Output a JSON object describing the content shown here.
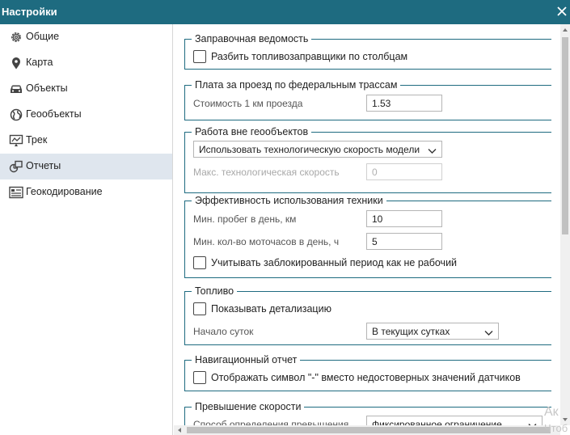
{
  "window": {
    "title": "Настройки",
    "close_icon": "close-icon"
  },
  "sidebar": {
    "items": [
      {
        "label": "Общие",
        "icon": "gear-icon",
        "active": false
      },
      {
        "label": "Карта",
        "icon": "map-pin-icon",
        "active": false
      },
      {
        "label": "Объекты",
        "icon": "car-icon",
        "active": false
      },
      {
        "label": "Геообъекты",
        "icon": "globe-icon",
        "active": false
      },
      {
        "label": "Трек",
        "icon": "track-monitor-icon",
        "active": false
      },
      {
        "label": "Отчеты",
        "icon": "reports-shapes-icon",
        "active": true
      },
      {
        "label": "Геокодирование",
        "icon": "address-card-icon",
        "active": false
      }
    ]
  },
  "sections": {
    "fuel_sheet": {
      "title": "Заправочная ведомость",
      "split_checkbox_label": "Разбить топливозаправщики по столбцам"
    },
    "toll": {
      "title": "Плата за проезд по федеральным трассам",
      "cost_label": "Стоимость 1 км проезда",
      "cost_value": "1.53"
    },
    "outside_geo": {
      "title": "Работа вне геообъектов",
      "mode_value": "Использовать технологическую скорость модели",
      "max_speed_label": "Макс. технологическая скорость",
      "max_speed_value": "0"
    },
    "efficiency": {
      "title": "Эффективность использования техники",
      "min_mileage_label": "Мин. пробег в день, км",
      "min_mileage_value": "10",
      "min_hours_label": "Мин. кол-во моточасов в день, ч",
      "min_hours_value": "5",
      "blocked_checkbox_label": "Учитывать заблокированный период как не рабочий"
    },
    "fuel": {
      "title": "Топливо",
      "detail_checkbox_label": "Показывать детализацию",
      "day_start_label": "Начало суток",
      "day_start_value": "В текущих сутках"
    },
    "nav_report": {
      "title": "Навигационный отчет",
      "symbol_checkbox_label": "Отображать символ \"-\" вместо недостоверных значений датчиков"
    },
    "speeding": {
      "title": "Превышение скорости",
      "method_label": "Способ определения превышения",
      "method_value": "Фиксированное ограничение"
    }
  },
  "watermark": {
    "line1": "Ак",
    "line2": "Чтоб"
  }
}
